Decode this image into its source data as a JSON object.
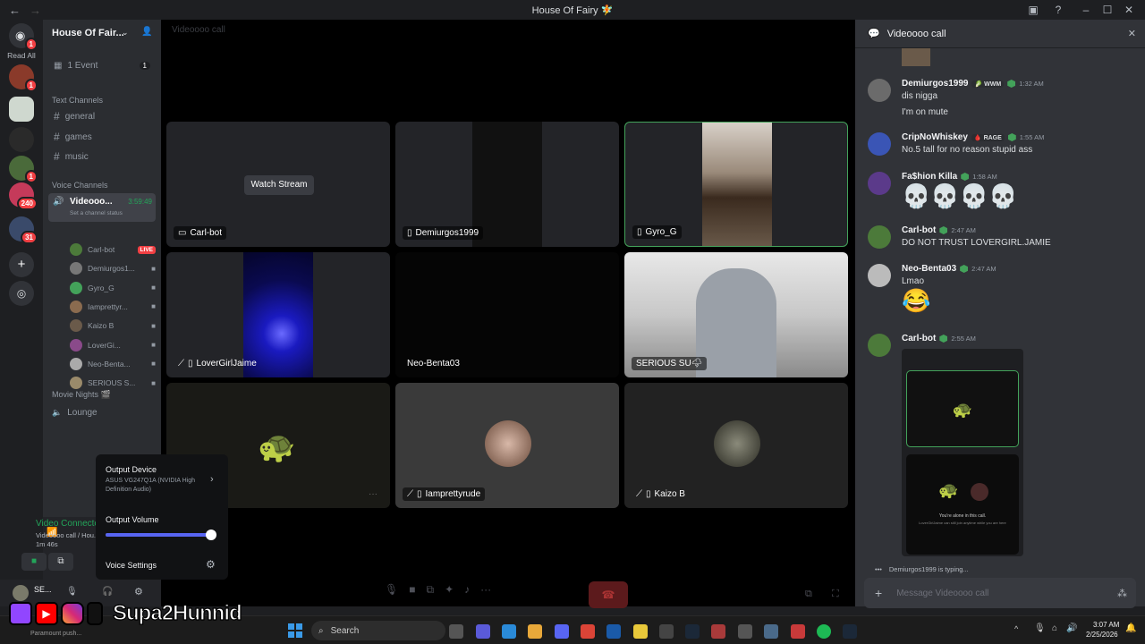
{
  "window": {
    "title": "House Of Fairy 🧚",
    "controls": [
      "–",
      "☐",
      "✕"
    ]
  },
  "rail": {
    "read_all_label": "Read All",
    "home_badge": "1",
    "badges": [
      "1",
      "1",
      "1",
      "240",
      "31"
    ]
  },
  "sidebar": {
    "server_name": "House Of Fair...",
    "event_label": "1 Event",
    "event_count": "1",
    "text_category": "Text Channels",
    "text_channels": [
      "general",
      "games",
      "music"
    ],
    "voice_category": "Voice Channels",
    "voice_channel": {
      "name": "Videooo...",
      "duration": "3:59:49",
      "status_hint": "Set a channel status"
    },
    "voice_users": [
      {
        "name": "Carl-bot",
        "live": "LIVE",
        "color": "#4c7a3a"
      },
      {
        "name": "Demiurgos1...",
        "color": "#777"
      },
      {
        "name": "Gyro_G",
        "color": "#43a25a"
      },
      {
        "name": "Iamprettyr...",
        "color": "#8a6b4f"
      },
      {
        "name": "Kaizo B",
        "color": "#6a5a4a"
      },
      {
        "name": "LoverGi...",
        "color": "#8a4a8a"
      },
      {
        "name": "Neo-Benta...",
        "color": "#aaa"
      },
      {
        "name": "SERIOUS S...",
        "color": "#9a8a6a"
      }
    ],
    "movie_category": "Movie Nights 🎬",
    "movie_channel": "Lounge"
  },
  "voice_panel": {
    "status": "Video Connected",
    "detail": "Videoooo call / Hou...",
    "elapsed": "1m 46s",
    "user_short": "SE..."
  },
  "popover": {
    "output_device_label": "Output Device",
    "output_device_value": "ASUS VG247Q1A (NVIDIA High Definition Audio)",
    "output_volume_label": "Output Volume",
    "output_volume": 0.95,
    "voice_settings_label": "Voice Settings"
  },
  "call": {
    "title": "Videoooo call",
    "watch_stream_label": "Watch Stream",
    "tiles": [
      {
        "label": "Carl-bot"
      },
      {
        "label": "Demiurgos1999"
      },
      {
        "label": "Gyro_G"
      },
      {
        "label": "LoverGirlJaime"
      },
      {
        "label": "Neo-Benta03"
      },
      {
        "label": "SERIOUS SU🌩"
      },
      {
        "label": ""
      },
      {
        "label": "Iamprettyrude"
      },
      {
        "label": "Kaizo B"
      }
    ]
  },
  "chat": {
    "header": "Videoooo call",
    "messages": [
      {
        "user": "Demiurgos1999",
        "tag": "🥬 WWM",
        "time": "1:32 AM",
        "lines": [
          "dis nigga",
          "I'm on mute"
        ],
        "color": "#6b6b6b"
      },
      {
        "user": "CripNoWhiskey",
        "tag": "🩸 RAGE",
        "time": "1:55 AM",
        "lines": [
          "No.5 tall for no reason stupid ass"
        ],
        "color": "#3a55b5"
      },
      {
        "user": "Fa$hion Killa",
        "tag": "",
        "time": "1:58 AM",
        "lines": [
          "💀💀💀💀"
        ],
        "color": "#5b3a8a"
      },
      {
        "user": "Carl-bot",
        "tag": "",
        "time": "2:47 AM",
        "lines": [
          "DO NOT TRUST LOVERGIRL.JAMIE"
        ],
        "color": "#4c7a3a"
      },
      {
        "user": "Neo-Benta03",
        "tag": "",
        "time": "2:47 AM",
        "lines": [
          "Lmao",
          "😂"
        ],
        "color": "#bbb"
      },
      {
        "user": "Carl-bot",
        "tag": "",
        "time": "2:55 AM",
        "lines": [],
        "color": "#4c7a3a"
      }
    ],
    "embed_caption": "You're alone in this call.",
    "embed_subcaption": "LoverGirlJaime can still join anytime while you are here",
    "typing": "Demiurgos1999 is typing...",
    "composer_placeholder": "Message Videoooo call"
  },
  "taskbar": {
    "search_placeholder": "Search",
    "time": "3:07 AM",
    "date": "2/25/2026"
  },
  "overlay": {
    "handle": "Supa2Hunnid",
    "ticker": "Paramount push..."
  }
}
